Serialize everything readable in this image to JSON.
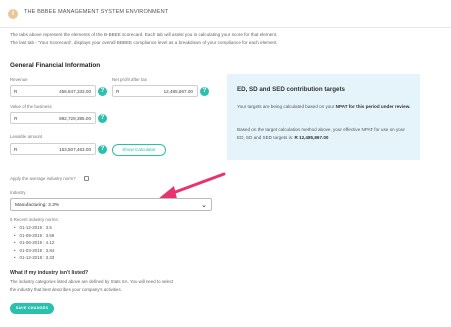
{
  "header": {
    "title": "THE BBBEE MANAGEMENT SYSTEM ENVIRONMENT",
    "info_icon": "i"
  },
  "intro": {
    "line1": "The tabs above represent the elements of the B-BBEE scorecard. Each tab will assist you in calculating your score for that element.",
    "line2": "The last tab - 'Your Scorecard', displays your overall BBBEE compliance level as a breakdown of your compliance for each element."
  },
  "financial": {
    "title": "General Financial Information",
    "currency": "R",
    "revenue": {
      "label": "Revenue",
      "value": "458,847,333.00"
    },
    "net_profit": {
      "label": "Net profit after tax",
      "value": "12,485,867.00"
    },
    "valuation": {
      "label": "Value of the business",
      "value": "892,729,395.00"
    },
    "leviable": {
      "label": "Leviable amount",
      "value": "153,507,463.00"
    },
    "help_glyph": "?",
    "calc_button": "Show Calculator"
  },
  "contribution": {
    "title": "ED, SD and SED contribution targets",
    "p1_text": "Your targets are being calculated based on your ",
    "p1_bold": "NPAT for this period under review.",
    "p2_text": "Based on the target calculation method above, your effective NPAT for use on your ED, SD and SED targets is: ",
    "p2_bold": "R 12,485,867.00"
  },
  "industry": {
    "average_label": "Apply the average industry norm?",
    "label": "Industry",
    "selected": "Manufacturing: 3.3%",
    "recent_label": "5 Recent industry norms:",
    "recent": [
      "01-12-2019 : 3.5",
      "01-09-2019 : 3.59",
      "01-06-2019 : 4.12",
      "01-03-2019 : 3.84",
      "01-12-2018 : 3.33"
    ]
  },
  "faq": {
    "title": "What if my industry isn't listed?",
    "line1": "The industry categories listed above are defined by Stats SA. You will need to select",
    "line2": "the industry that best describes your company's activities."
  },
  "save_button": "SAVE CHANGES",
  "colors": {
    "accent": "#2bbfae",
    "panel": "#e5f4fb",
    "arrow": "#e8336e"
  }
}
